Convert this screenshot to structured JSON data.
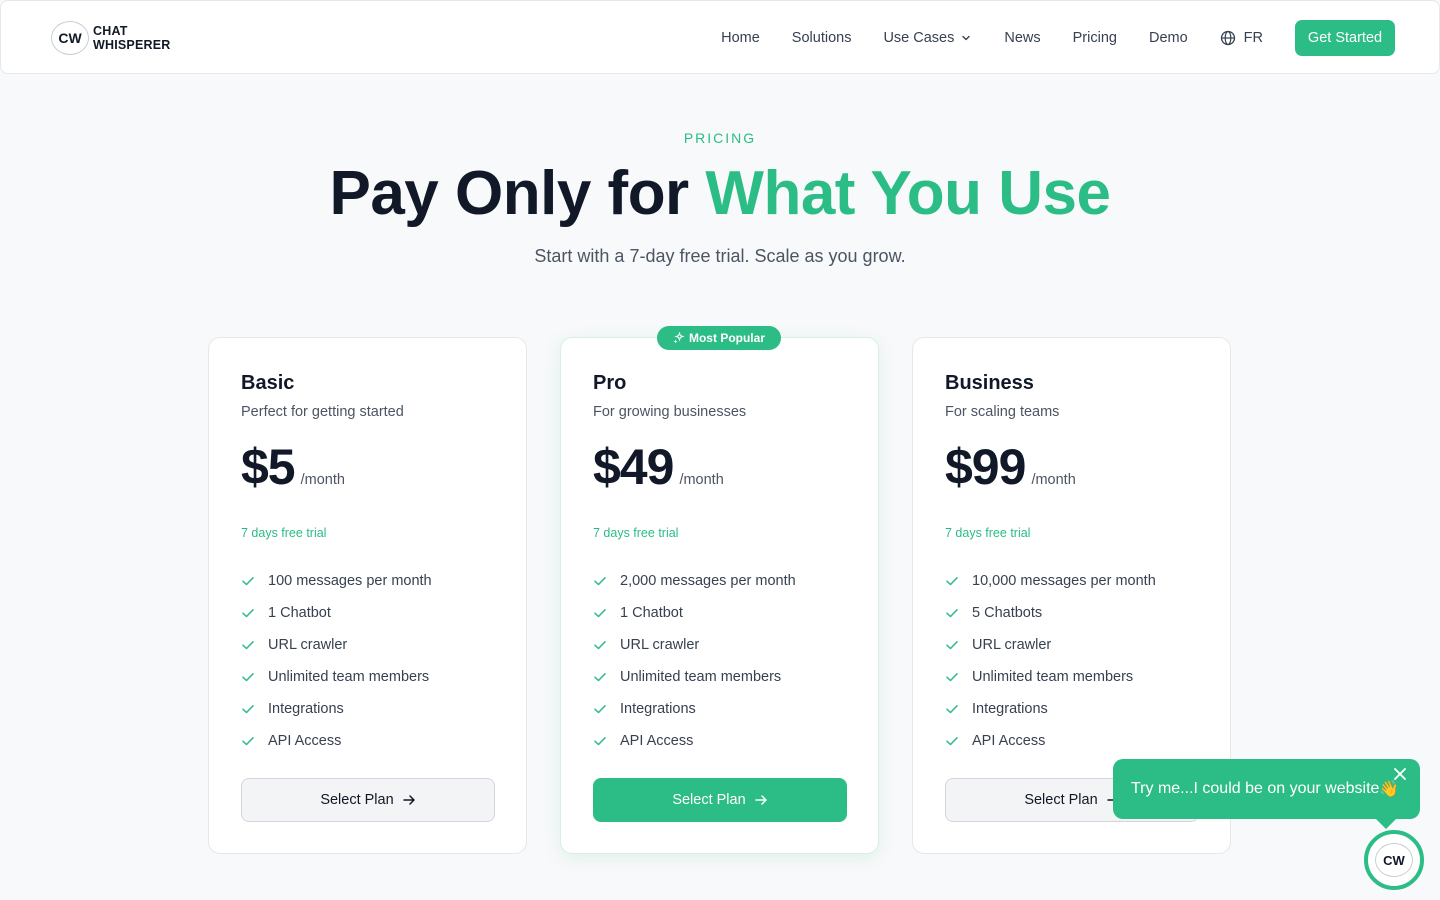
{
  "nav": {
    "logo_mark": "CW",
    "logo_line1": "CHAT",
    "logo_line2": "WHISPERER",
    "links": [
      {
        "label": "Home"
      },
      {
        "label": "Solutions"
      },
      {
        "label": "Use Cases"
      },
      {
        "label": "News"
      },
      {
        "label": "Pricing"
      },
      {
        "label": "Demo"
      }
    ],
    "language": "FR",
    "cta": "Get Started"
  },
  "hero": {
    "eyebrow": "PRICING",
    "headline_main": "Pay Only for ",
    "headline_accent": "What You Use",
    "subhead": "Start with a 7-day free trial. Scale as you grow."
  },
  "plans": [
    {
      "name": "Basic",
      "desc": "Perfect for getting started",
      "price": "$5",
      "period": "/month",
      "trial": "7 days free trial",
      "features": [
        "100 messages per month",
        "1 Chatbot",
        "URL crawler",
        "Unlimited team members",
        "Integrations",
        "API Access"
      ],
      "button": "Select Plan"
    },
    {
      "name": "Pro",
      "badge": "Most Popular",
      "desc": "For growing businesses",
      "price": "$49",
      "period": "/month",
      "trial": "7 days free trial",
      "features": [
        "2,000 messages per month",
        "1 Chatbot",
        "URL crawler",
        "Unlimited team members",
        "Integrations",
        "API Access"
      ],
      "button": "Select Plan"
    },
    {
      "name": "Business",
      "desc": "For scaling teams",
      "price": "$99",
      "period": "/month",
      "trial": "7 days free trial",
      "features": [
        "10,000 messages per month",
        "5 Chatbots",
        "URL crawler",
        "Unlimited team members",
        "Integrations",
        "API Access"
      ],
      "button": "Select Plan"
    }
  ],
  "chat": {
    "message": "Try me...I could be on your website",
    "emoji": "👋",
    "avatar_mark": "CW"
  },
  "colors": {
    "accent": "#2bbd85",
    "text": "#111827",
    "muted": "#4b5563",
    "background": "#f8f9fa"
  }
}
